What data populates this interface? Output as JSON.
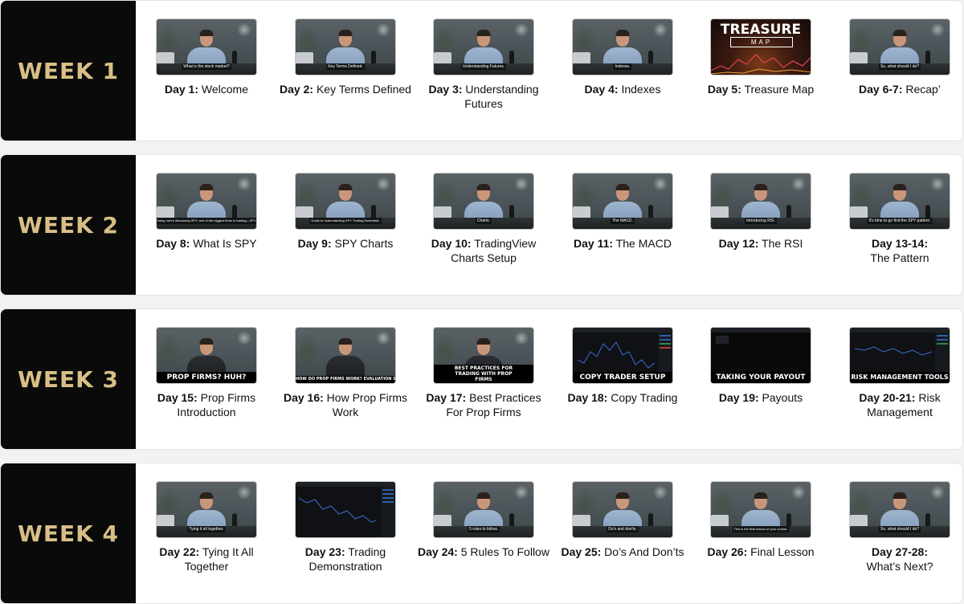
{
  "weeks": [
    {
      "label": "WEEK 1",
      "lessons": [
        {
          "day": "Day 1:",
          "title": "Welcome",
          "subtitle": "What is the stock market?"
        },
        {
          "day": "Day 2:",
          "title": "Key Terms Defined",
          "subtitle": "Key Terms Defined."
        },
        {
          "day": "Day 3:",
          "title": "Understanding Futures",
          "subtitle": "Understanding Futures."
        },
        {
          "day": "Day 4:",
          "title": "Indexes",
          "subtitle": "Indexes."
        },
        {
          "day": "Day 5:",
          "title": "Treasure Map",
          "thumb_title": "TREASURE",
          "thumb_box": "MAP"
        },
        {
          "day": "Day 6-7:",
          "title": "Recap’",
          "subtitle": "So, what should I do?"
        }
      ]
    },
    {
      "label": "WEEK 2",
      "lessons": [
        {
          "day": "Day 8:",
          "title": "What Is SPY",
          "subtitle": "Today, we're discussing SPY, one of the biggest firms in trading—SPY."
        },
        {
          "day": "Day 9:",
          "title": "SPY Charts",
          "subtitle": "Guide to understanding SPY Trading Essentials."
        },
        {
          "day": "Day 10:",
          "title": "TradingView Charts Setup",
          "subtitle": "Charts."
        },
        {
          "day": "Day 11:",
          "title": "The MACD",
          "subtitle": "The MACD."
        },
        {
          "day": "Day 12:",
          "title": "The RSI",
          "subtitle": "Introducing RSI."
        },
        {
          "day": "Day 13-14:",
          "title": "The Pattern",
          "subtitle": "It's time to go find the SPY pattern."
        }
      ]
    },
    {
      "label": "WEEK 3",
      "lessons": [
        {
          "day": "Day 15:",
          "title": "Prop Firms Introduction",
          "banner": "PROP FIRMS? HUH?"
        },
        {
          "day": "Day 16:",
          "title": "How Prop Firms Work",
          "banner": "HOW DO PROP FIRMS WORK? EVALUATION STAGE"
        },
        {
          "day": "Day 17:",
          "title": "Best Practices For Prop Firms",
          "banner": "BEST PRACTICES FOR TRADING WITH PROP FIRMS"
        },
        {
          "day": "Day 18:",
          "title": "Copy Trading",
          "banner": "COPY TRADER SETUP"
        },
        {
          "day": "Day 19:",
          "title": "Payouts",
          "banner": "TAKING YOUR PAYOUT"
        },
        {
          "day": "Day 20-21:",
          "title": "Risk Management",
          "banner": "RISK MANAGEMENT TOOLS"
        }
      ]
    },
    {
      "label": "WEEK 4",
      "lessons": [
        {
          "day": "Day 22:",
          "title": "Tying It All Together",
          "subtitle": "Tying it all together."
        },
        {
          "day": "Day 23:",
          "title": "Trading Demonstration"
        },
        {
          "day": "Day 24:",
          "title": "5 Rules To Follow",
          "subtitle": "5 rules to follow."
        },
        {
          "day": "Day 25:",
          "title": "Do’s And Don’ts",
          "subtitle": "Do's and don'ts."
        },
        {
          "day": "Day 26:",
          "title": "Final Lesson",
          "subtitle": "This is the final lesson of your course."
        },
        {
          "day": "Day 27-28:",
          "title": "What’s Next?",
          "subtitle": "So, what should I do?"
        }
      ]
    }
  ]
}
